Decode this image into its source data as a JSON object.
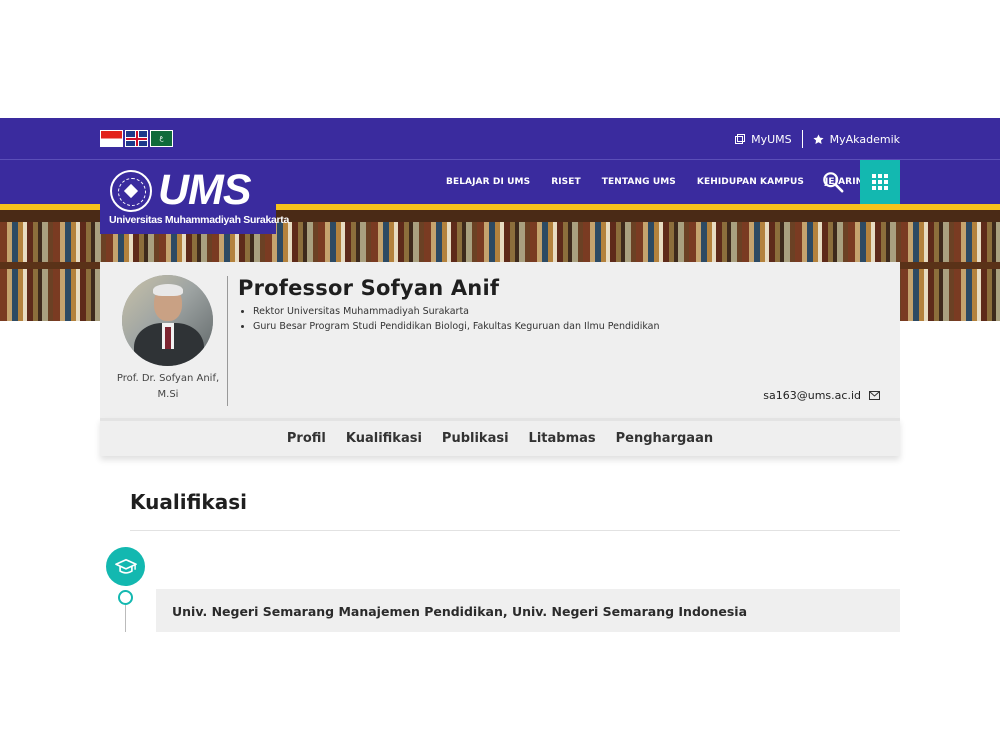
{
  "topbar": {
    "flags": [
      "flag-indonesia",
      "flag-uk",
      "flag-arabic"
    ],
    "links": [
      {
        "label": "MyUMS",
        "icon": "window-icon"
      },
      {
        "label": "MyAkademik",
        "icon": "star-icon"
      }
    ]
  },
  "logo": {
    "title": "UMS",
    "subtitle": "Universitas Muhammadiyah Surakarta"
  },
  "nav": {
    "items": [
      "BELAJAR DI UMS",
      "RISET",
      "TENTANG UMS",
      "KEHIDUPAN KAMPUS",
      "JEJARING"
    ]
  },
  "profile": {
    "name": "Professor Sofyan Anif",
    "photo_caption": "Prof. Dr. Sofyan Anif, M.Si",
    "positions": [
      "Rektor Universitas Muhammadiyah Surakarta",
      "Guru Besar Program Studi Pendidikan Biologi, Fakultas Keguruan dan Ilmu Pendidikan"
    ],
    "email": "sa163@ums.ac.id"
  },
  "tabs": [
    "Profil",
    "Kualifikasi",
    "Publikasi",
    "Litabmas",
    "Penghargaan"
  ],
  "section": {
    "title": "Kualifikasi",
    "items": [
      "Univ. Negeri Semarang Manajemen Pendidikan, Univ. Negeri Semarang Indonesia"
    ]
  },
  "colors": {
    "primary": "#3a2b9e",
    "accent": "#13b8b0",
    "yellow": "#f7c21b"
  }
}
